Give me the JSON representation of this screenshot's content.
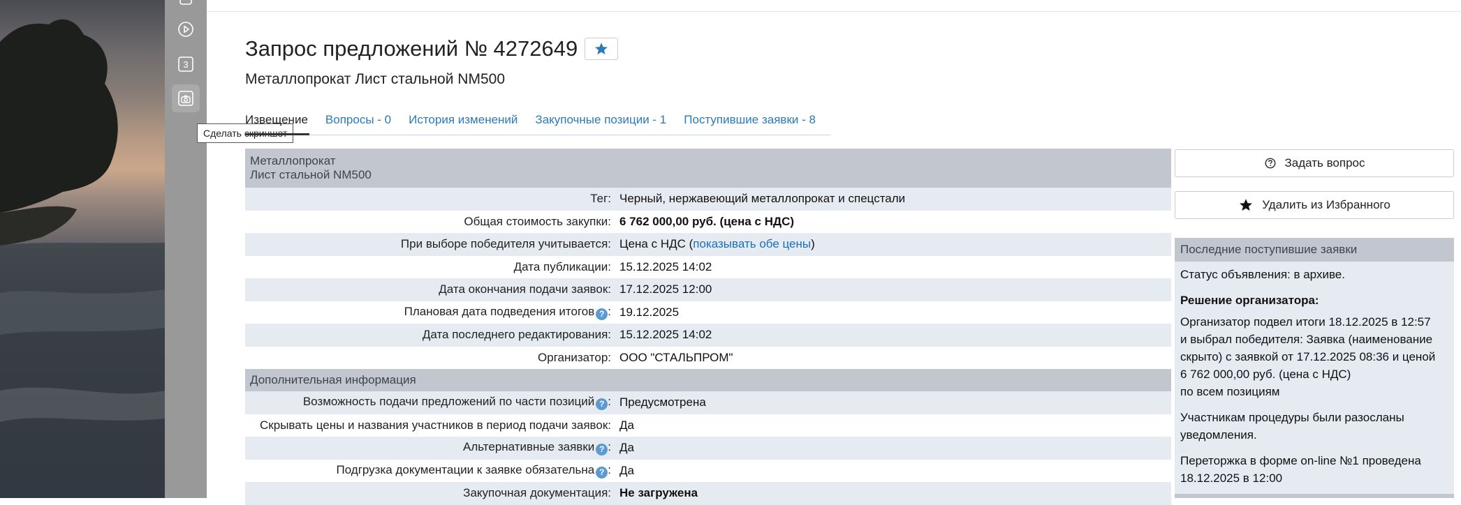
{
  "toolbar": {
    "badge_number": "3",
    "tooltip": "Сделать скриншот",
    "icons": [
      "play-icon",
      "number-three-icon",
      "camera-icon"
    ]
  },
  "page": {
    "title": "Запрос предложений № 4272649",
    "subtitle": "Металлопрокат Лист стальной NM500"
  },
  "tabs": [
    {
      "label": "Извещение",
      "active": true
    },
    {
      "label": "Вопросы - 0",
      "active": false
    },
    {
      "label": "История изменений",
      "active": false
    },
    {
      "label": "Закупочные позиции - 1",
      "active": false
    },
    {
      "label": "Поступившие заявки - 8",
      "active": false
    }
  ],
  "main": {
    "group1_title_line1": "Металлопрокат",
    "group1_title_line2": "Лист стальной NM500",
    "rows1": [
      {
        "label": "Тег:",
        "value": "Черный, нержавеющий металлопрокат и спецстали"
      },
      {
        "label": "Общая стоимость закупки:",
        "value": "6 762 000,00 руб. (цена с НДС)"
      },
      {
        "label": "При выборе победителя учитывается:",
        "value_prefix": "Цена с НДС (",
        "value_link": "показывать обе цены",
        "value_suffix": ")"
      },
      {
        "label": "Дата публикации:",
        "value": "15.12.2025 14:02"
      },
      {
        "label": "Дата окончания подачи заявок:",
        "value": "17.12.2025 12:00"
      },
      {
        "label": "Плановая дата подведения итогов",
        "help": "?",
        "colon": ":",
        "value": "19.12.2025"
      },
      {
        "label": "Дата последнего редактирования:",
        "value": "15.12.2025 14:02"
      },
      {
        "label": "Организатор:",
        "value": "ООО \"СТАЛЬПРОМ\""
      }
    ],
    "group2_title": "Дополнительная информация",
    "rows2": [
      {
        "label": "Возможность подачи предложений по части позиций",
        "help": "?",
        "colon": ":",
        "value": "Предусмотрена"
      },
      {
        "label": "Скрывать цены и названия участников в период подачи заявок:",
        "value": "Да"
      },
      {
        "label": "Альтернативные заявки",
        "help": "?",
        "colon": ":",
        "value": "Да"
      },
      {
        "label": "Подгрузка документации к заявке обязательна",
        "help": "?",
        "colon": ":",
        "value": "Да"
      },
      {
        "label": "Закупочная документация:",
        "value": "Не загружена"
      }
    ]
  },
  "right": {
    "ask_button": "Задать вопрос",
    "fav_button": "Удалить из Избранного",
    "panel_title": "Последние поступившие заявки",
    "status": "Статус объявления: в архиве.",
    "decision_title": "Решение организатора:",
    "decision_text": [
      "Организатор подвел итоги 18.12.2025 в 12:57",
      "и выбрал победителя: Заявка (наименование",
      "скрыто) с заявкой от 17.12.2025 08:36 и ценой",
      "6 762 000,00 руб. (цена с НДС)",
      "по всем позициям"
    ],
    "notice_text": [
      "Участникам процедуры были разосланы",
      "уведомления."
    ],
    "rebid_text": [
      "Переторжка в форме on-line №1 проведена",
      "18.12.2025 в 12:00"
    ]
  },
  "colors": {
    "link": "#1a6fbf",
    "accent": "#2a7ab8",
    "deadline": "#d9133b",
    "header_bg": "#c2c7cf",
    "row_alt_bg": "#e6ebf2",
    "toolbar_bg": "#999999"
  }
}
